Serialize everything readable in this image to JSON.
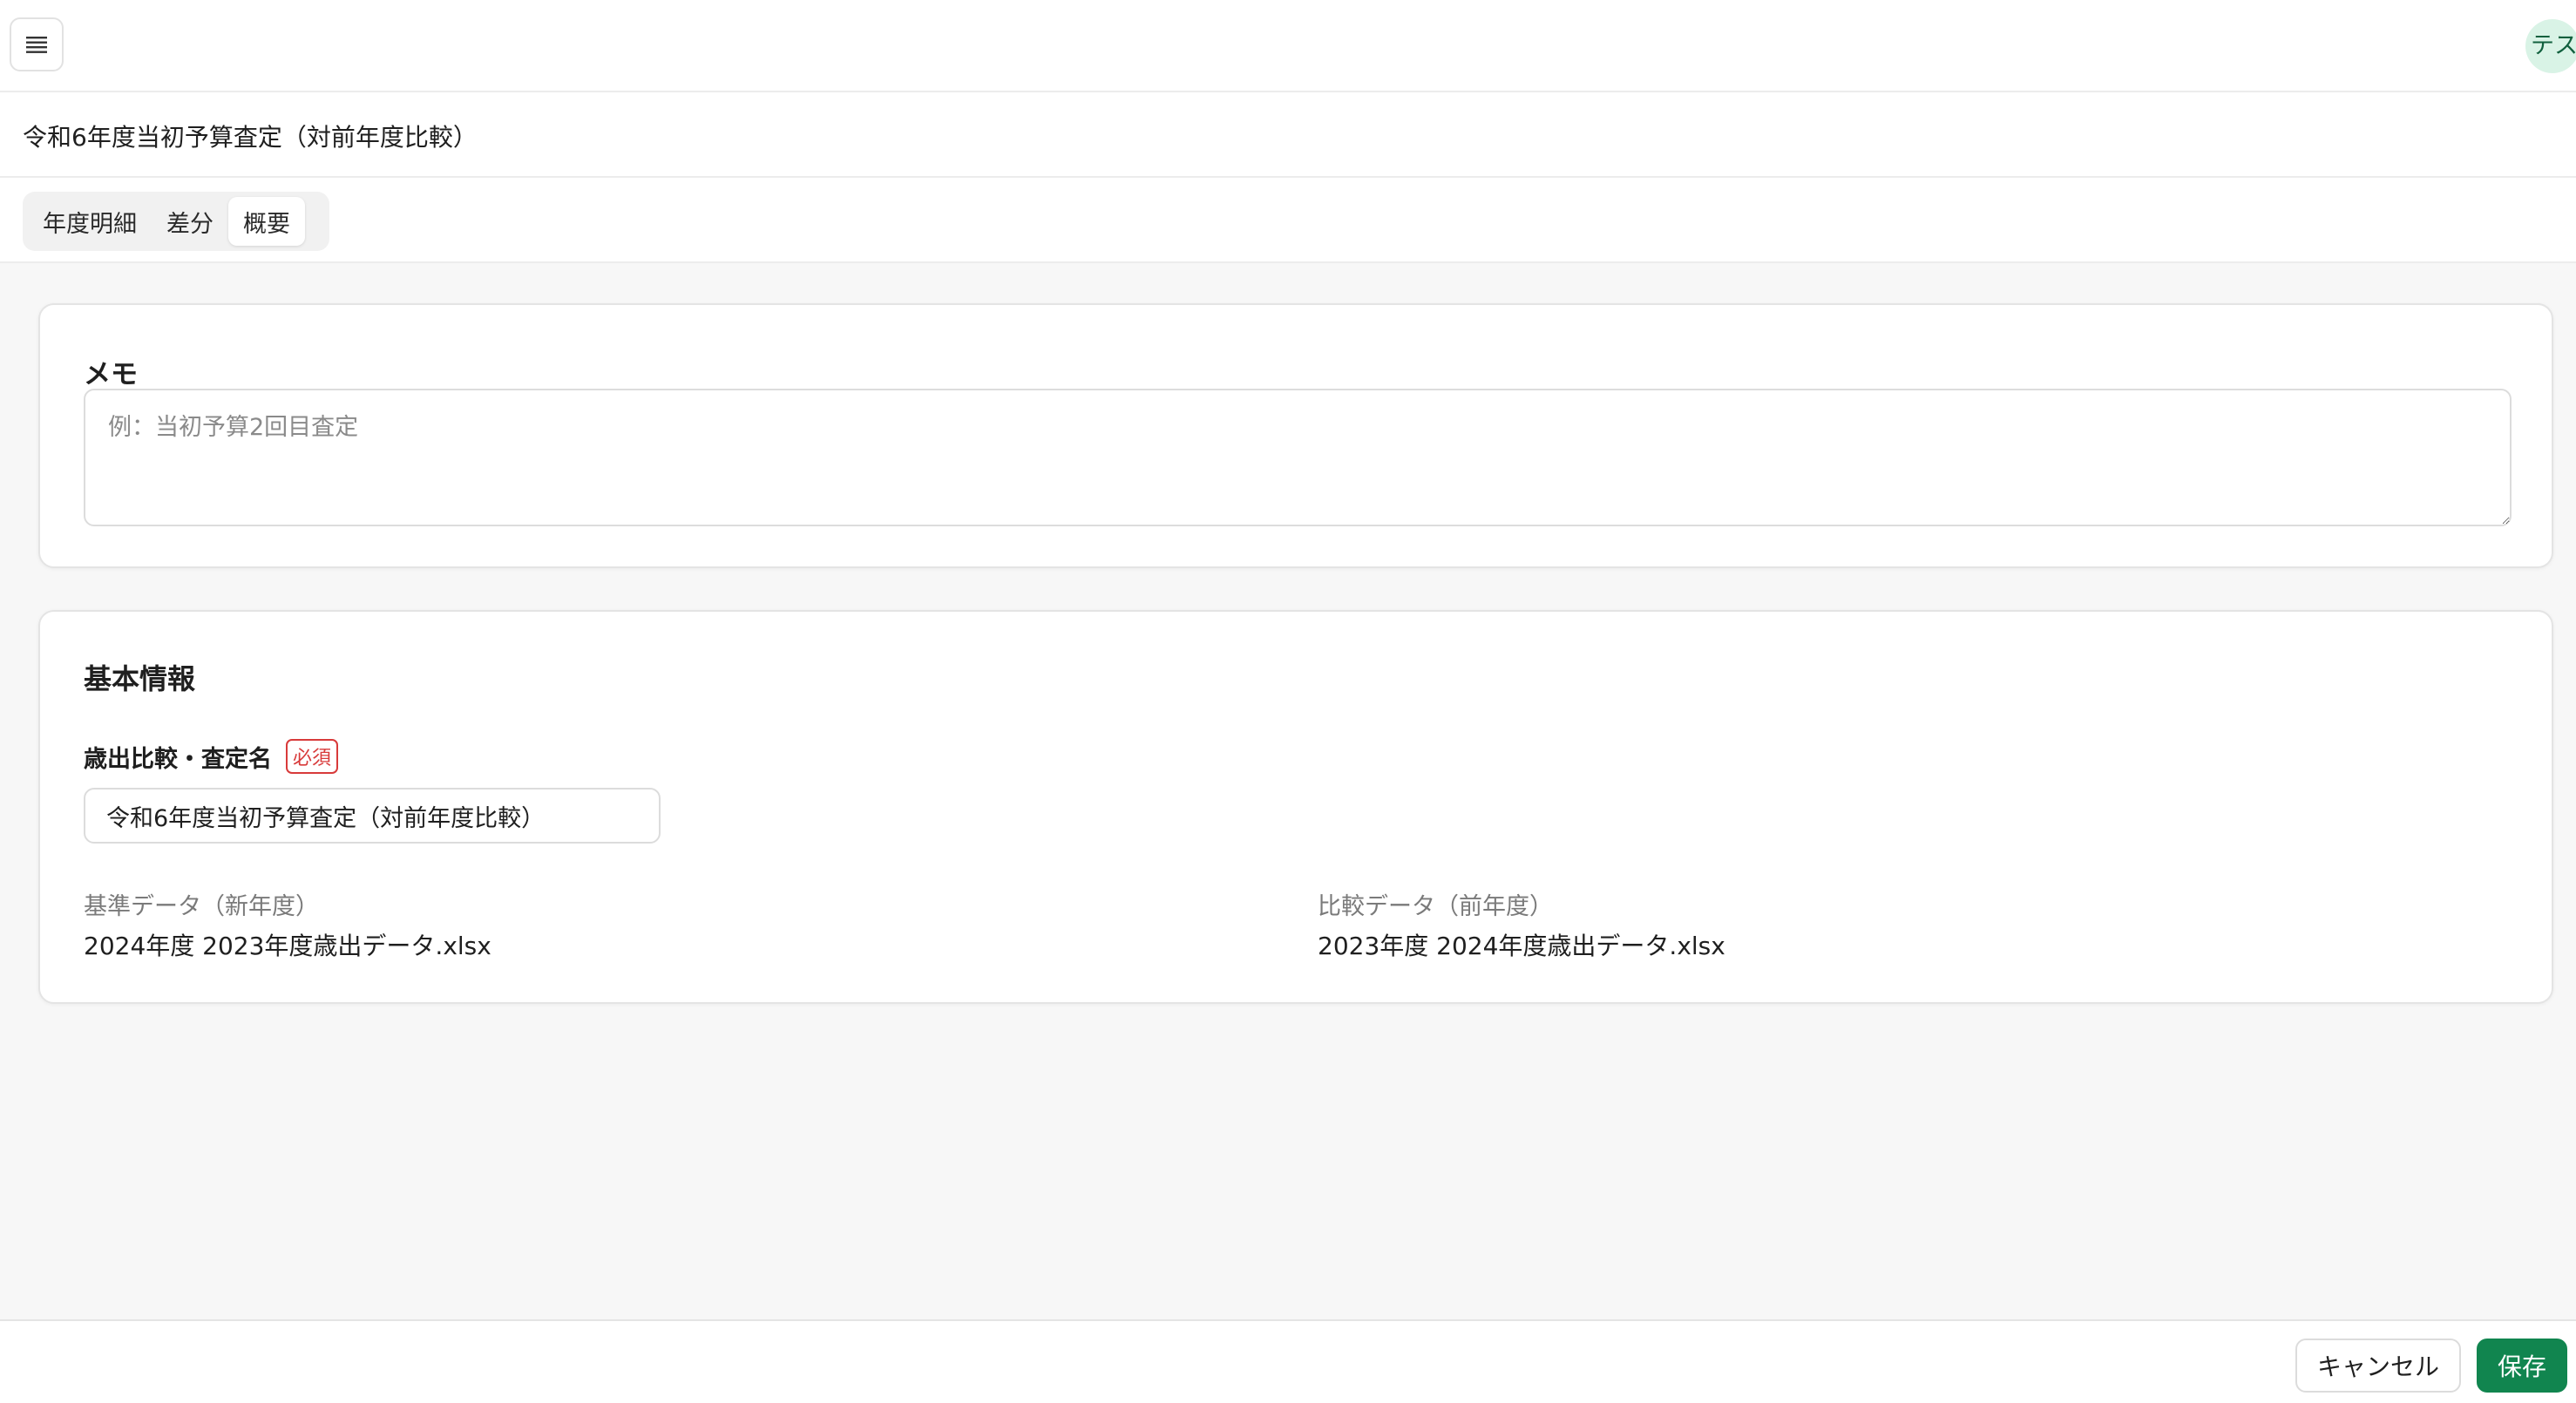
{
  "header": {
    "menu_icon": "hamburger-menu-icon",
    "avatar_text": "テス",
    "avatar_color": "#d9f3e6"
  },
  "title_bar": {
    "title": "令和6年度当初予算査定（対前年度比較）"
  },
  "tabs": [
    {
      "label": "年度明細",
      "active": false
    },
    {
      "label": "差分",
      "active": false
    },
    {
      "label": "概要",
      "active": true
    }
  ],
  "memo": {
    "label": "メモ",
    "placeholder": "例：当初予算2回目査定",
    "value": ""
  },
  "basic_info": {
    "title": "基本情報",
    "name_field": {
      "label": "歳出比較・査定名",
      "required_badge": "必須",
      "value": "令和6年度当初予算査定（対前年度比較）"
    },
    "base_data": {
      "label": "基準データ（新年度）",
      "value": "2024年度 2023年度歳出データ.xlsx"
    },
    "compare_data": {
      "label": "比較データ（前年度）",
      "value": "2023年度 2024年度歳出データ.xlsx"
    }
  },
  "footer": {
    "cancel_label": "キャンセル",
    "save_label": "保存",
    "save_color": "#11854f"
  }
}
